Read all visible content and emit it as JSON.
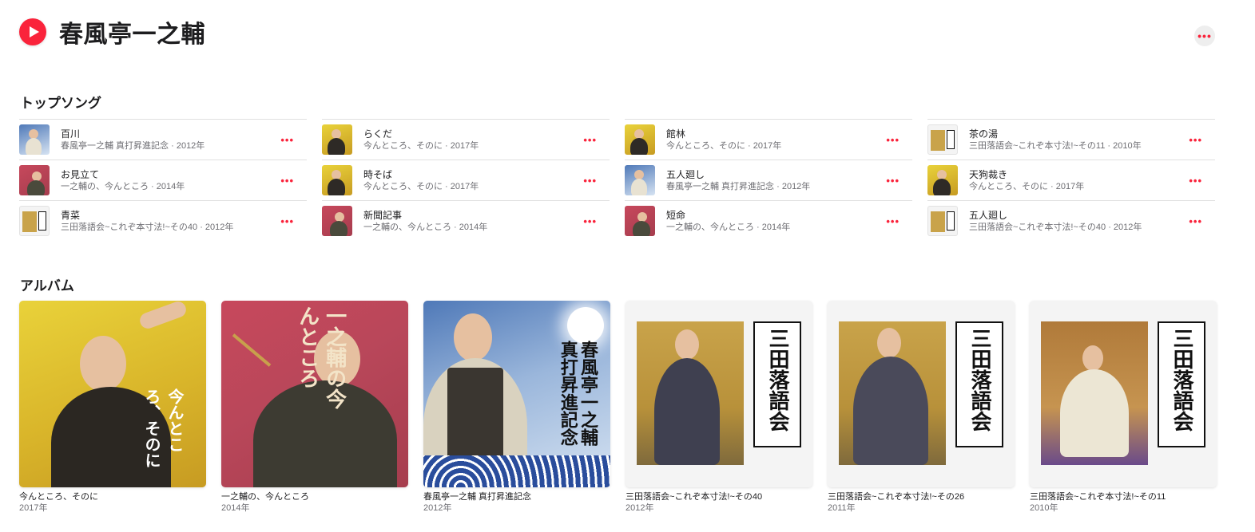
{
  "artist": {
    "name": "春風亭一之輔"
  },
  "colors": {
    "accent": "#fa233b"
  },
  "icons": {
    "play": "play-icon",
    "more": "ellipsis-icon"
  },
  "sections": {
    "top_songs": "トップソング",
    "albums": "アルバム"
  },
  "songs": [
    [
      {
        "title": "百川",
        "subtitle": "春風亭一之輔 真打昇進記念 · 2012年"
      },
      {
        "title": "お見立て",
        "subtitle": "一之輔の、今んところ · 2014年"
      },
      {
        "title": "青菜",
        "subtitle": "三田落語会~これぞ本寸法!~その40 · 2012年"
      }
    ],
    [
      {
        "title": "らくだ",
        "subtitle": "今んところ、そのに · 2017年"
      },
      {
        "title": "時そば",
        "subtitle": "今んところ、そのに · 2017年"
      },
      {
        "title": "新聞記事",
        "subtitle": "一之輔の、今んところ · 2014年"
      }
    ],
    [
      {
        "title": "館林",
        "subtitle": "今んところ、そのに · 2017年"
      },
      {
        "title": "五人廻し",
        "subtitle": "春風亭一之輔 真打昇進記念 · 2012年"
      },
      {
        "title": "短命",
        "subtitle": "一之輔の、今んところ · 2014年"
      }
    ],
    [
      {
        "title": "茶の湯",
        "subtitle": "三田落語会~これぞ本寸法!~その11 · 2010年"
      },
      {
        "title": "天狗裁き",
        "subtitle": "今んところ、そのに · 2017年"
      },
      {
        "title": "五人廻し",
        "subtitle": "三田落語会~これぞ本寸法!~その40 · 2012年"
      }
    ]
  ],
  "albums": [
    {
      "title": "今んところ、そのに",
      "year": "2017年",
      "art_text": "今んところ、そのに"
    },
    {
      "title": "一之輔の、今んところ",
      "year": "2014年",
      "art_text": "一之輔の今んところ"
    },
    {
      "title": "春風亭一之輔 真打昇進記念",
      "year": "2012年",
      "art_text": "春風亭一之輔真打昇進記念"
    },
    {
      "title": "三田落語会~これぞ本寸法!~その40",
      "year": "2012年",
      "art_text": "三田落語会"
    },
    {
      "title": "三田落語会~これぞ本寸法!~その26",
      "year": "2011年",
      "art_text": "三田落語会"
    },
    {
      "title": "三田落語会~これぞ本寸法!~その11",
      "year": "2010年",
      "art_text": "三田落語会"
    }
  ]
}
